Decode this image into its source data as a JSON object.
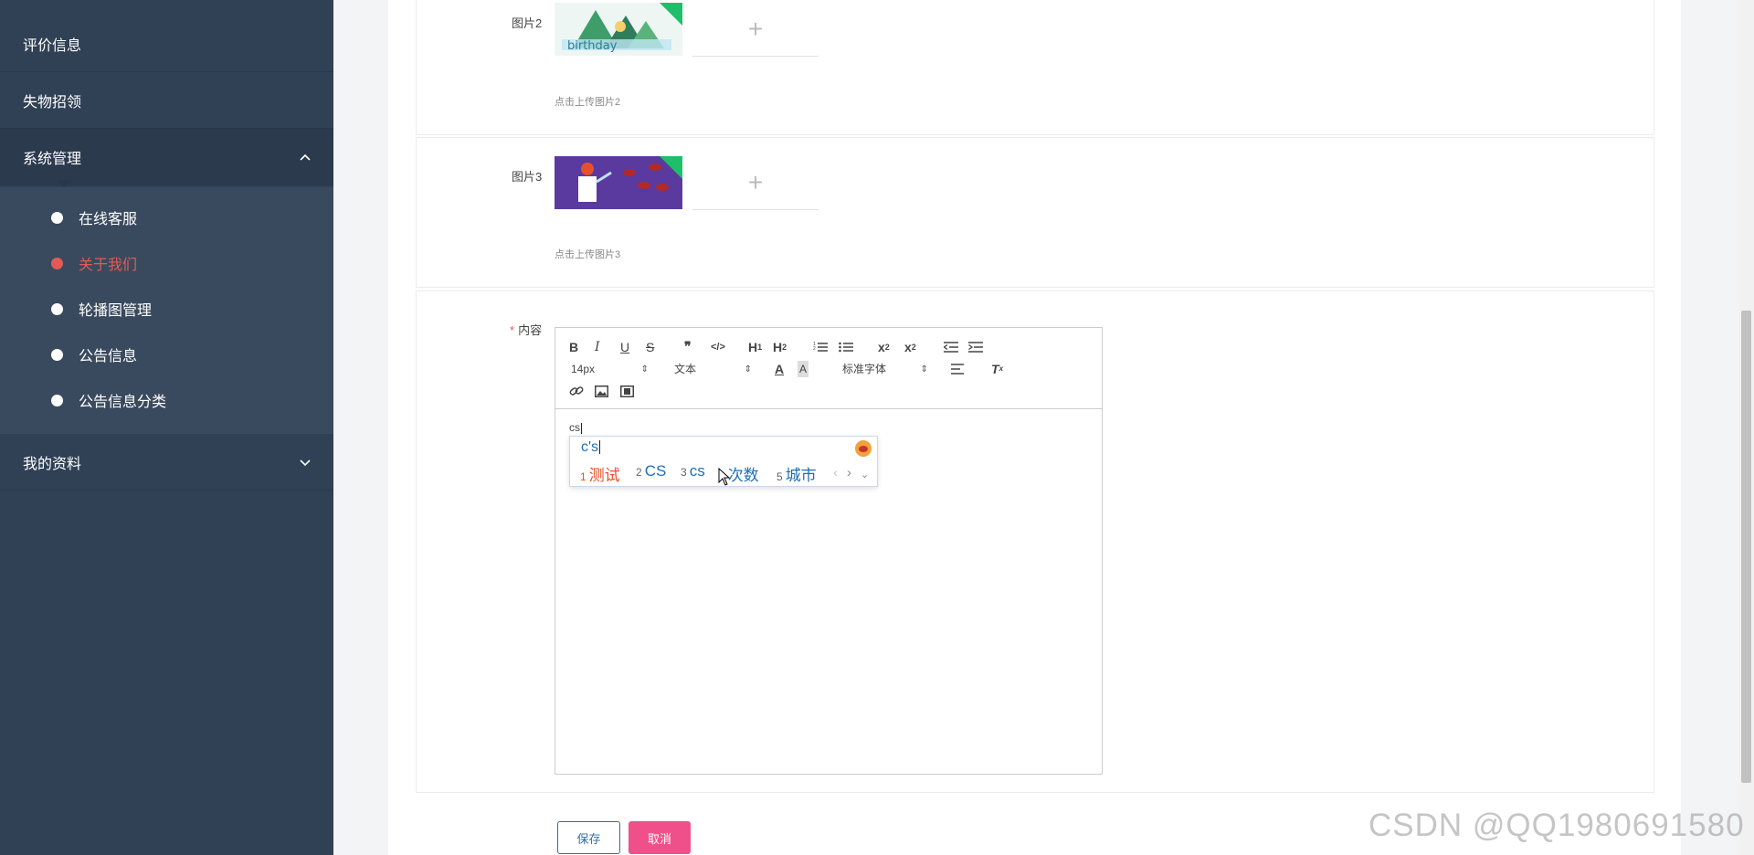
{
  "sidebar": {
    "items": [
      {
        "label": "评价信息"
      },
      {
        "label": "失物招领"
      },
      {
        "label": "系统管理"
      },
      {
        "label": "我的资料"
      }
    ],
    "submenu": [
      {
        "label": "在线客服",
        "active": false
      },
      {
        "label": "关于我们",
        "active": true
      },
      {
        "label": "轮播图管理",
        "active": false
      },
      {
        "label": "公告信息",
        "active": false
      },
      {
        "label": "公告信息分类",
        "active": false
      }
    ]
  },
  "form": {
    "image2": {
      "label": "图片2",
      "hint": "点击上传图片2"
    },
    "image3": {
      "label": "图片3",
      "hint": "点击上传图片3"
    },
    "content": {
      "required_mark": "*",
      "label": "内容"
    },
    "upload_plus": "+"
  },
  "editor": {
    "font_size": "14px",
    "block_format": "文本",
    "font_family": "标准字体",
    "content": "cs"
  },
  "ime": {
    "composition": "c's",
    "candidates": [
      {
        "num": "1",
        "text": "测试"
      },
      {
        "num": "2",
        "text": "CS"
      },
      {
        "num": "3",
        "text": "cs"
      },
      {
        "num": "4",
        "text": "次数"
      },
      {
        "num": "5",
        "text": "城市"
      }
    ]
  },
  "buttons": {
    "save": "保存",
    "cancel": "取消"
  },
  "watermark": "CSDN @QQ1980691580",
  "colors": {
    "sidebar_bg": "#304156",
    "active": "#e25a56",
    "cancel_bg": "#f0508a",
    "save_border": "#2e6fa3"
  }
}
